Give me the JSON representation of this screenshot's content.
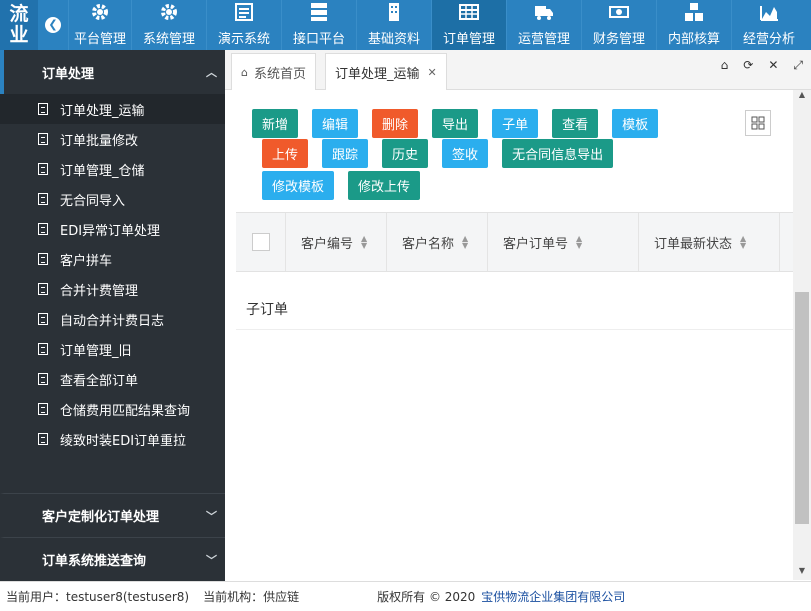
{
  "brand": {
    "logo_line1": "流",
    "logo_line2": "业"
  },
  "topnav": {
    "items": [
      {
        "label": "平台管理",
        "icon": "gear-icon"
      },
      {
        "label": "系统管理",
        "icon": "gear-icon"
      },
      {
        "label": "演示系统",
        "icon": "form-icon"
      },
      {
        "label": "接口平台",
        "icon": "server-icon"
      },
      {
        "label": "基础资料",
        "icon": "building-icon"
      },
      {
        "label": "订单管理",
        "icon": "table-icon",
        "active": true
      },
      {
        "label": "运营管理",
        "icon": "truck-icon"
      },
      {
        "label": "财务管理",
        "icon": "money-icon"
      },
      {
        "label": "内部核算",
        "icon": "cubes-icon"
      },
      {
        "label": "经营分析",
        "icon": "area-chart-icon"
      }
    ]
  },
  "sidebar": {
    "section_title": "订单处理",
    "items": [
      {
        "label": "订单处理_运输",
        "active": true
      },
      {
        "label": "订单批量修改"
      },
      {
        "label": "订单管理_仓储"
      },
      {
        "label": "无合同导入"
      },
      {
        "label": "EDI异常订单处理"
      },
      {
        "label": "客户拼车"
      },
      {
        "label": "合并计费管理"
      },
      {
        "label": "自动合并计费日志"
      },
      {
        "label": "订单管理_旧"
      },
      {
        "label": "查看全部订单"
      },
      {
        "label": "仓储费用匹配结果查询"
      },
      {
        "label": "绫致时装EDI订单重拉"
      }
    ],
    "collapsed_sections": [
      "客户定制化订单处理",
      "订单系统推送查询"
    ]
  },
  "tabs": [
    {
      "label": "系统首页",
      "icon": "home-icon"
    },
    {
      "label": "订单处理_运输",
      "closable": true,
      "active": true
    }
  ],
  "toolbar": {
    "row1": [
      {
        "label": "新增",
        "color": "#1b9a88"
      },
      {
        "label": "编辑",
        "color": "#2baeee"
      },
      {
        "label": "删除",
        "color": "#f05a2b"
      },
      {
        "label": "导出",
        "color": "#1b9a88"
      },
      {
        "label": "子单",
        "color": "#2baeee"
      },
      {
        "label": "查看",
        "color": "#1b9a88"
      },
      {
        "label": "模板",
        "color": "#2baeee"
      }
    ],
    "row2": [
      {
        "label": "上传",
        "color": "#f05a2b"
      },
      {
        "label": "跟踪",
        "color": "#2baeee"
      },
      {
        "label": "历史",
        "color": "#1b9a88"
      },
      {
        "label": "签收",
        "color": "#2baeee"
      },
      {
        "label": "无合同信息导出",
        "color": "#1b9a88"
      }
    ],
    "row3": [
      {
        "label": "修改模板",
        "color": "#2baeee"
      },
      {
        "label": "修改上传",
        "color": "#1b9a88"
      }
    ]
  },
  "table": {
    "columns": [
      "客户编号",
      "客户名称",
      "客户订单号",
      "订单最新状态"
    ]
  },
  "subsection": {
    "title": "子订单"
  },
  "footer": {
    "user_label": "当前用户：",
    "user_value": "testuser8(testuser8)",
    "org_label": "当前机构：",
    "org_value": "供应链",
    "copyright": "版权所有 © 2020",
    "company": "宝供物流企业集团有限公司"
  }
}
